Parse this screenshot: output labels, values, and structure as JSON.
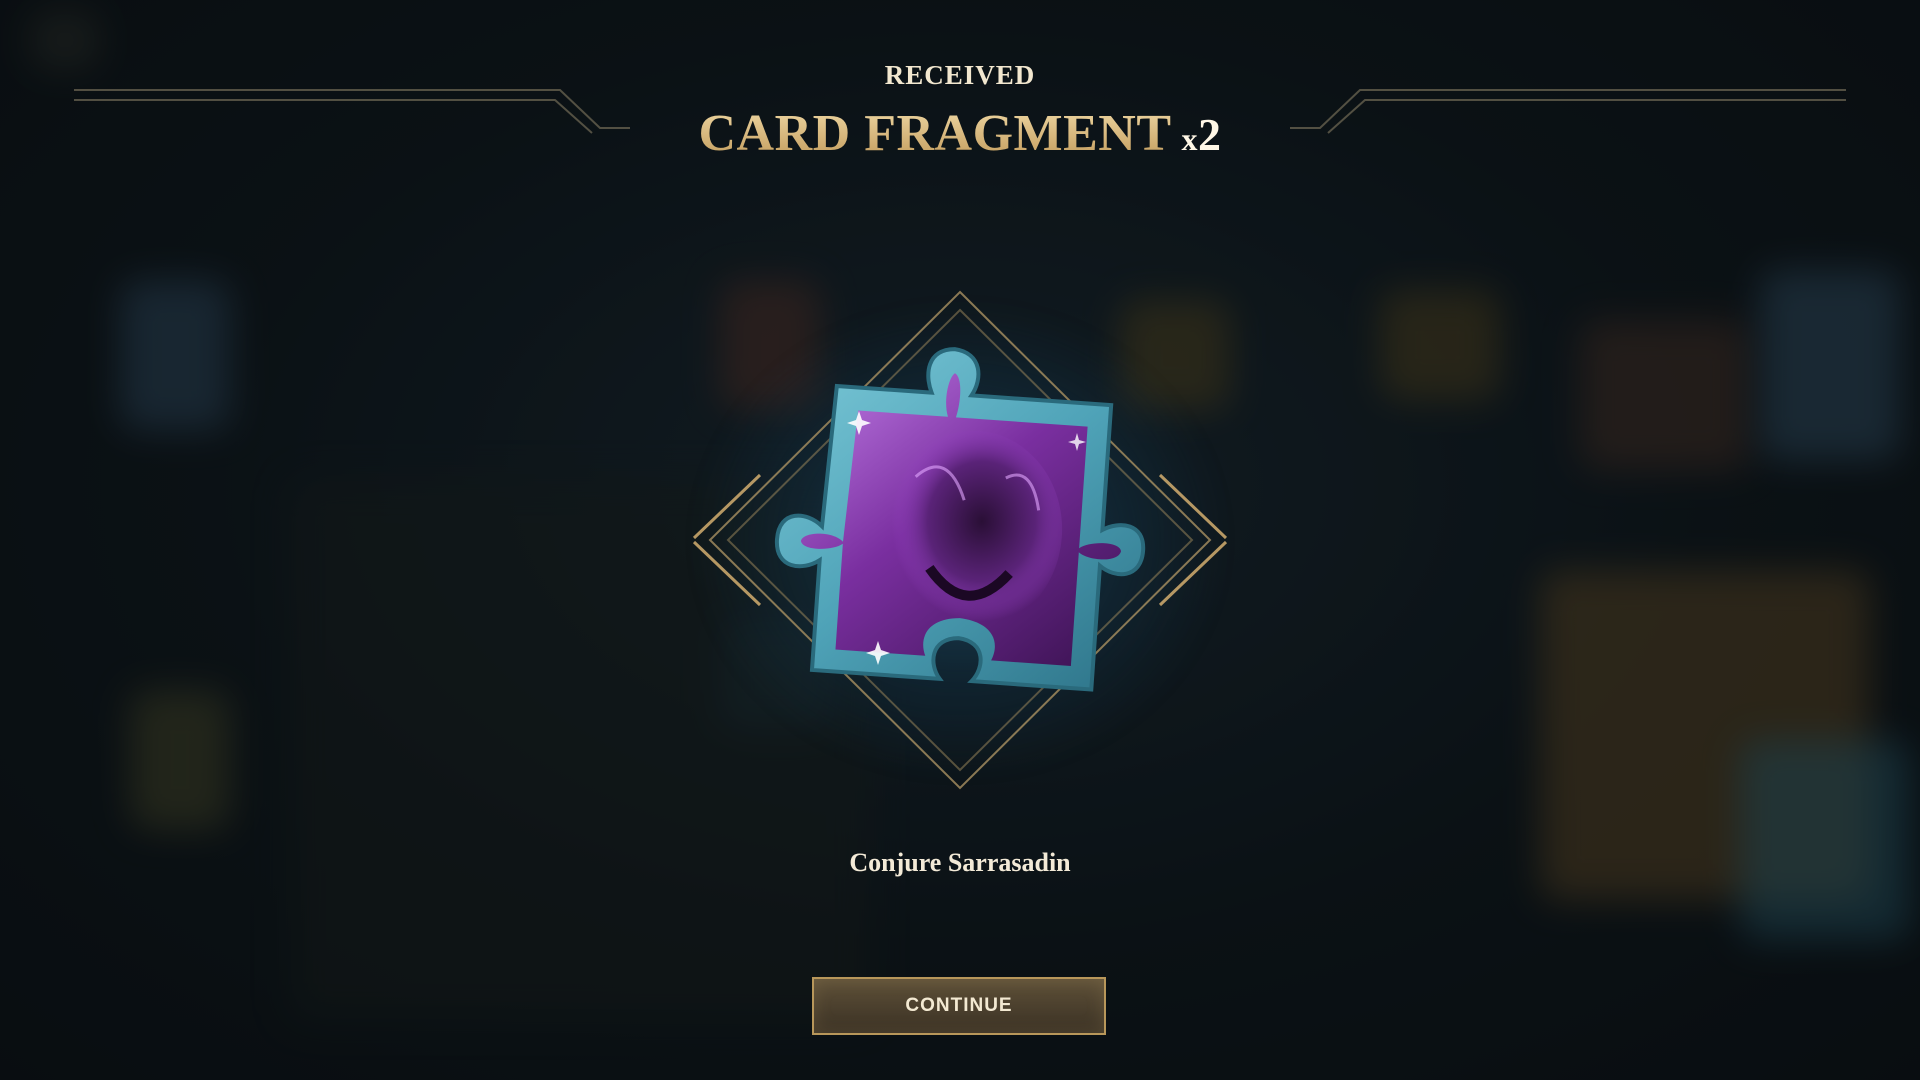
{
  "header": {
    "received_label": "RECEIVED",
    "reward_title": "CARD FRAGMENT",
    "quantity_prefix": "x",
    "quantity": "2"
  },
  "reward": {
    "item_name": "Conjure Sarrasadin",
    "icon": "puzzle-piece-card-fragment-icon"
  },
  "actions": {
    "continue_label": "CONTINUE"
  },
  "colors": {
    "gold_accent": "#c9a66b",
    "frame_teal": "#4fa3b8",
    "art_purple": "#9a44c8",
    "background": "#0e1418"
  }
}
